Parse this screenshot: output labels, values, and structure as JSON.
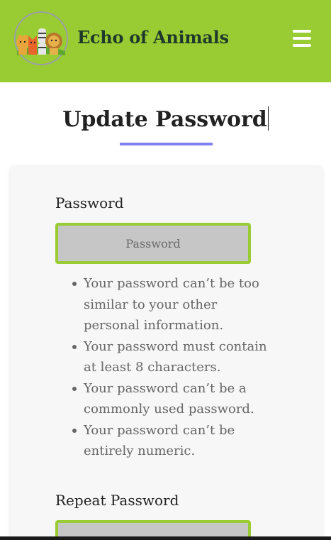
{
  "header": {
    "brand": "Echo of Animals",
    "menu_icon": "hamburger-menu-icon",
    "logo_icon": "animal-group-logo-icon",
    "background_color": "#99cc33"
  },
  "main": {
    "title": "Update Password",
    "accent_color": "#8080f0"
  },
  "form": {
    "password_label": "Password",
    "password_placeholder": "Password",
    "password_rules": [
      "Your password can’t be too similar to your other personal information.",
      "Your password must contain at least 8 characters.",
      "Your password can’t be a commonly used password.",
      "Your password can’t be entirely numeric."
    ],
    "repeat_label": "Repeat Password",
    "field_border_color": "#99cc33"
  }
}
